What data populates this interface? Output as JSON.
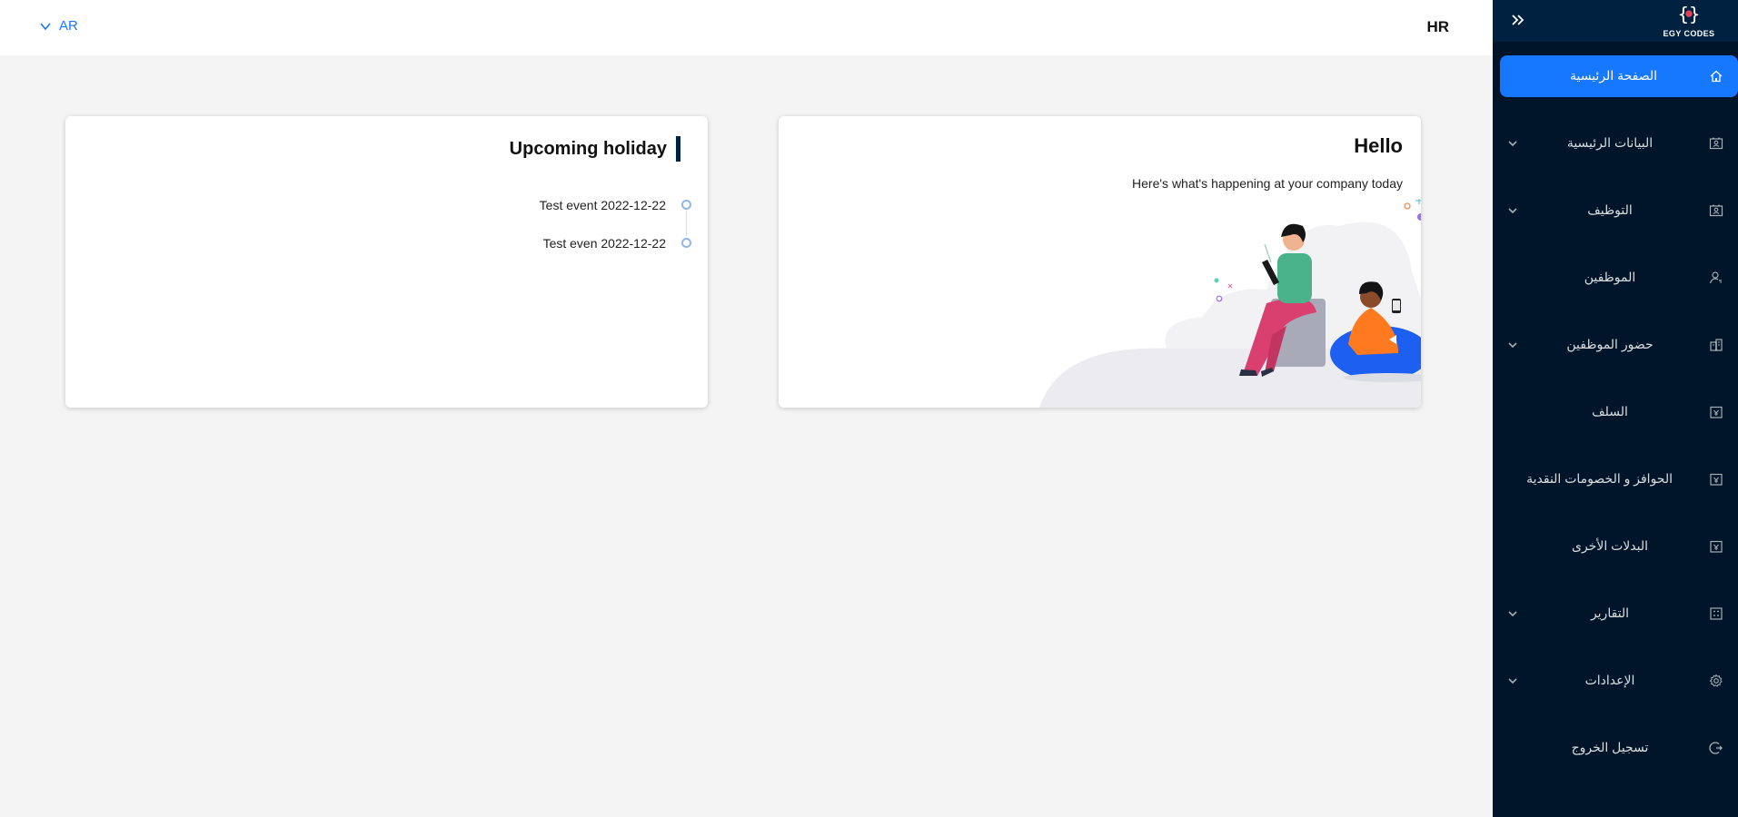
{
  "header": {
    "language_label": "AR",
    "title": "HR"
  },
  "sidebar": {
    "logo_text": "EGY CODES",
    "items": [
      {
        "label": "الصفحة الرئيسية",
        "icon": "home-icon",
        "active": true,
        "has_submenu": false
      },
      {
        "label": "البيانات الرئيسية",
        "icon": "contacts-icon",
        "active": false,
        "has_submenu": true
      },
      {
        "label": "التوظيف",
        "icon": "contacts-icon",
        "active": false,
        "has_submenu": true
      },
      {
        "label": "الموظفين",
        "icon": "user-switch-icon",
        "active": false,
        "has_submenu": false
      },
      {
        "label": "حضور الموظفين",
        "icon": "attendance-icon",
        "active": false,
        "has_submenu": true
      },
      {
        "label": "السلف",
        "icon": "money-icon",
        "active": false,
        "has_submenu": false
      },
      {
        "label": "الحوافز و الخصومات النقدية",
        "icon": "money-icon",
        "active": false,
        "has_submenu": false
      },
      {
        "label": "البدلات الأخرى",
        "icon": "money-icon",
        "active": false,
        "has_submenu": false
      },
      {
        "label": "التقارير",
        "icon": "report-icon",
        "active": false,
        "has_submenu": true
      },
      {
        "label": "الإعدادات",
        "icon": "gear-icon",
        "active": false,
        "has_submenu": true
      },
      {
        "label": "تسجيل الخروج",
        "icon": "logout-icon",
        "active": false,
        "has_submenu": false
      }
    ]
  },
  "hello_card": {
    "title": "Hello",
    "subtitle": "Here's what's happening at your company today"
  },
  "holiday_card": {
    "title": "Upcoming holiday",
    "events": [
      {
        "text": "Test event 2022-12-22"
      },
      {
        "text": "Test even 2022-12-22"
      }
    ]
  },
  "colors": {
    "sidebar_bg": "#001529",
    "accent": "#1677ff",
    "page_bg": "#f4f4f4"
  }
}
